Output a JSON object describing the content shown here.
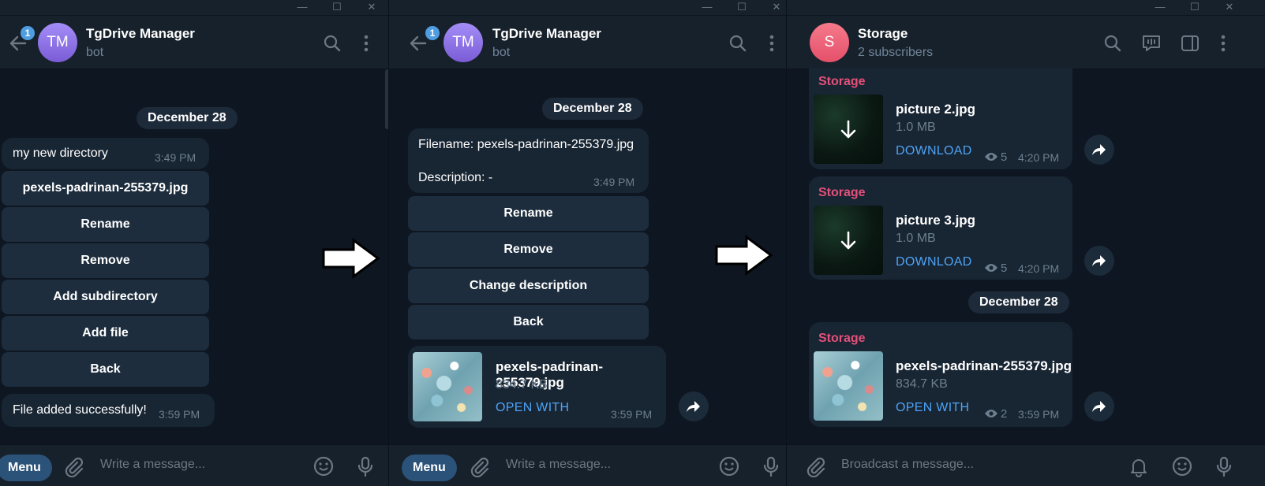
{
  "window": {
    "minimize": "—",
    "maximize": "☐",
    "close": "✕"
  },
  "panel1": {
    "header": {
      "badge": "1",
      "avatar": "TM",
      "title": "TgDrive Manager",
      "subtitle": "bot"
    },
    "date": "December 28",
    "message": {
      "text": "my new directory",
      "time": "3:49 PM"
    },
    "buttons": [
      "pexels-padrinan-255379.jpg",
      "Rename",
      "Remove",
      "Add subdirectory",
      "Add file",
      "Back"
    ],
    "message2": {
      "text": "File added successfully!",
      "time": "3:59 PM"
    },
    "composer": {
      "menu": "Menu",
      "placeholder": "Write a message..."
    }
  },
  "panel2": {
    "header": {
      "badge": "1",
      "avatar": "TM",
      "title": "TgDrive Manager",
      "subtitle": "bot"
    },
    "date": "December 28",
    "message": {
      "line1": "Filename: pexels-padrinan-255379.jpg",
      "line2": "Description: -",
      "time": "3:49 PM"
    },
    "buttons": [
      "Rename",
      "Remove",
      "Change description",
      "Back"
    ],
    "file": {
      "name": "pexels-padrinan-255379.jpg",
      "size": "834.7 KB",
      "action": "OPEN WITH",
      "time": "3:59 PM"
    },
    "composer": {
      "menu": "Menu",
      "placeholder": "Write a message..."
    }
  },
  "panel3": {
    "header": {
      "avatar": "S",
      "title": "Storage",
      "subtitle": "2 subscribers"
    },
    "posts": [
      {
        "channel": "Storage",
        "name": "picture 2.jpg",
        "size": "1.0 MB",
        "action": "DOWNLOAD",
        "views": "5",
        "time": "4:20 PM"
      },
      {
        "channel": "Storage",
        "name": "picture 3.jpg",
        "size": "1.0 MB",
        "action": "DOWNLOAD",
        "views": "5",
        "time": "4:20 PM"
      },
      {
        "channel": "Storage",
        "name": "pexels-padrinan-255379.jpg",
        "size": "834.7 KB",
        "action": "OPEN WITH",
        "views": "2",
        "time": "3:59 PM"
      }
    ],
    "date": "December 28",
    "composer": {
      "placeholder": "Broadcast a message..."
    }
  },
  "colors": {
    "bg": "#0e1621",
    "header": "#17212b",
    "bubble": "#182533",
    "link": "#4ea4f6",
    "channel": "#e5507a",
    "accent": "#2b5278"
  }
}
